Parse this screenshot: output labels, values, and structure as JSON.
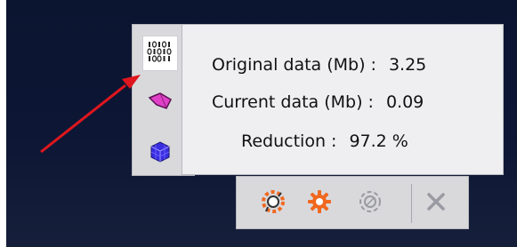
{
  "stats": {
    "original_label": "Original data (Mb) :",
    "original_value": "3.25",
    "current_label": "Current data (Mb) :",
    "current_value": "0.09",
    "reduction_label": "Reduction :",
    "reduction_value": "97.2 %"
  },
  "side_tabs": [
    {
      "icon": "binary-data-icon",
      "active": true
    },
    {
      "icon": "shape-surface-icon",
      "active": false
    },
    {
      "icon": "mesh-cube-icon",
      "active": false
    }
  ],
  "toolbar": {
    "tools": [
      "reduce-gear-icon",
      "settings-gear-icon",
      "reset-circle-icon",
      "close-icon"
    ]
  },
  "annotation": {
    "arrow_color": "#e0161e"
  },
  "colors": {
    "panel": "#efeff1",
    "tab_bar": "#d9d9dc",
    "viewport_background": "#0b1530",
    "gear_orange": "#f0681e",
    "shape_magenta": "#e040c8",
    "cube_blue": "#3a2ee0"
  }
}
